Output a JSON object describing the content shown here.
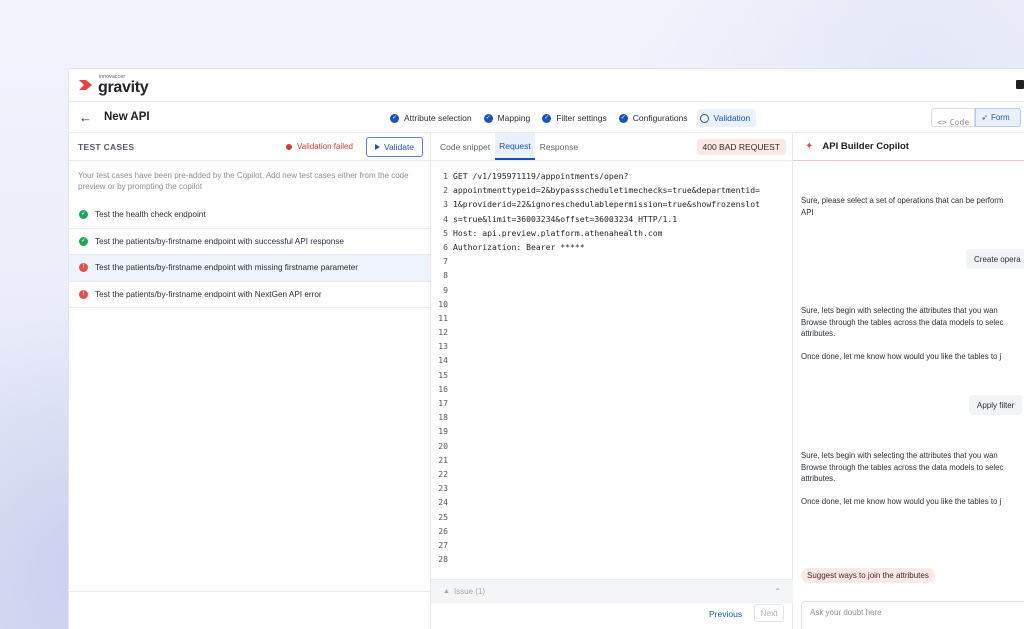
{
  "brand": {
    "small": "innovaccer",
    "name": "gravity"
  },
  "header": {
    "title": "New API",
    "steps": [
      {
        "label": "Attribute selection",
        "state": "done"
      },
      {
        "label": "Mapping",
        "state": "done"
      },
      {
        "label": "Filter settings",
        "state": "done"
      },
      {
        "label": "Configurations",
        "state": "done"
      },
      {
        "label": "Validation",
        "state": "active"
      }
    ],
    "mode": {
      "code_label": "Code",
      "form_label": "Form",
      "selected": "Form"
    }
  },
  "test_cases": {
    "title": "TEST CASES",
    "status": "Validation failed",
    "validate_label": "Validate",
    "description": "Your test cases have been pre-added by the Copilot. Add new test cases either from the code preview or by prompting the copilot",
    "items": [
      {
        "label": "Test the health check endpoint",
        "result": "pass"
      },
      {
        "label": "Test the patients/by-firstname endpoint with successful API response",
        "result": "pass"
      },
      {
        "label": "Test the patients/by-firstname endpoint with missing firstname parameter",
        "result": "fail"
      },
      {
        "label": "Test the patients/by-firstname endpoint with NextGen API error",
        "result": "fail"
      }
    ]
  },
  "code_panel": {
    "tabs": [
      "Code snippet",
      "Request",
      "Response"
    ],
    "active_tab": "Request",
    "status": "400 BAD REQUEST",
    "lines": [
      "GET /v1/195971119/appointments/open?",
      "appointmenttypeid=2&bypassscheduletimechecks=true&departmentid=",
      "1&providerid=22&ignoreschedulablepermission=true&showfrozenslot",
      "s=true&limit=36003234&offset=36003234 HTTP/1.1",
      "Host: api.preview.platform.athenahealth.com",
      "Authorization: Bearer *****",
      "",
      "",
      "",
      "",
      "",
      "",
      "",
      "",
      "",
      "",
      "",
      "",
      "",
      "",
      "",
      "",
      "",
      "",
      "",
      "",
      "",
      ""
    ],
    "issue_label": "Issue (1)",
    "previous_label": "Previous",
    "next_label": "Next"
  },
  "copilot": {
    "title": "API Builder Copilot",
    "messages": [
      {
        "lines": [
          "Sure, please select a set of operations that can be perform",
          "API"
        ]
      },
      {
        "lines": [
          "Sure, lets begin with selecting the attributes that you wan",
          "Browse through the tables across the data models to selec",
          "attributes.",
          "",
          "Once done, let me know how would you like the tables to j"
        ]
      },
      {
        "lines": [
          "Sure, lets begin with selecting the attributes that you wan",
          "Browse through the tables across the data models to selec",
          "attributes.",
          "",
          "Once done, let me know how would you like the tables to j"
        ]
      }
    ],
    "user_actions": [
      "Create opera",
      "Apply filter"
    ],
    "suggestion": "Suggest ways to join the attributes",
    "input_placeholder": "Ask your doubt here"
  }
}
